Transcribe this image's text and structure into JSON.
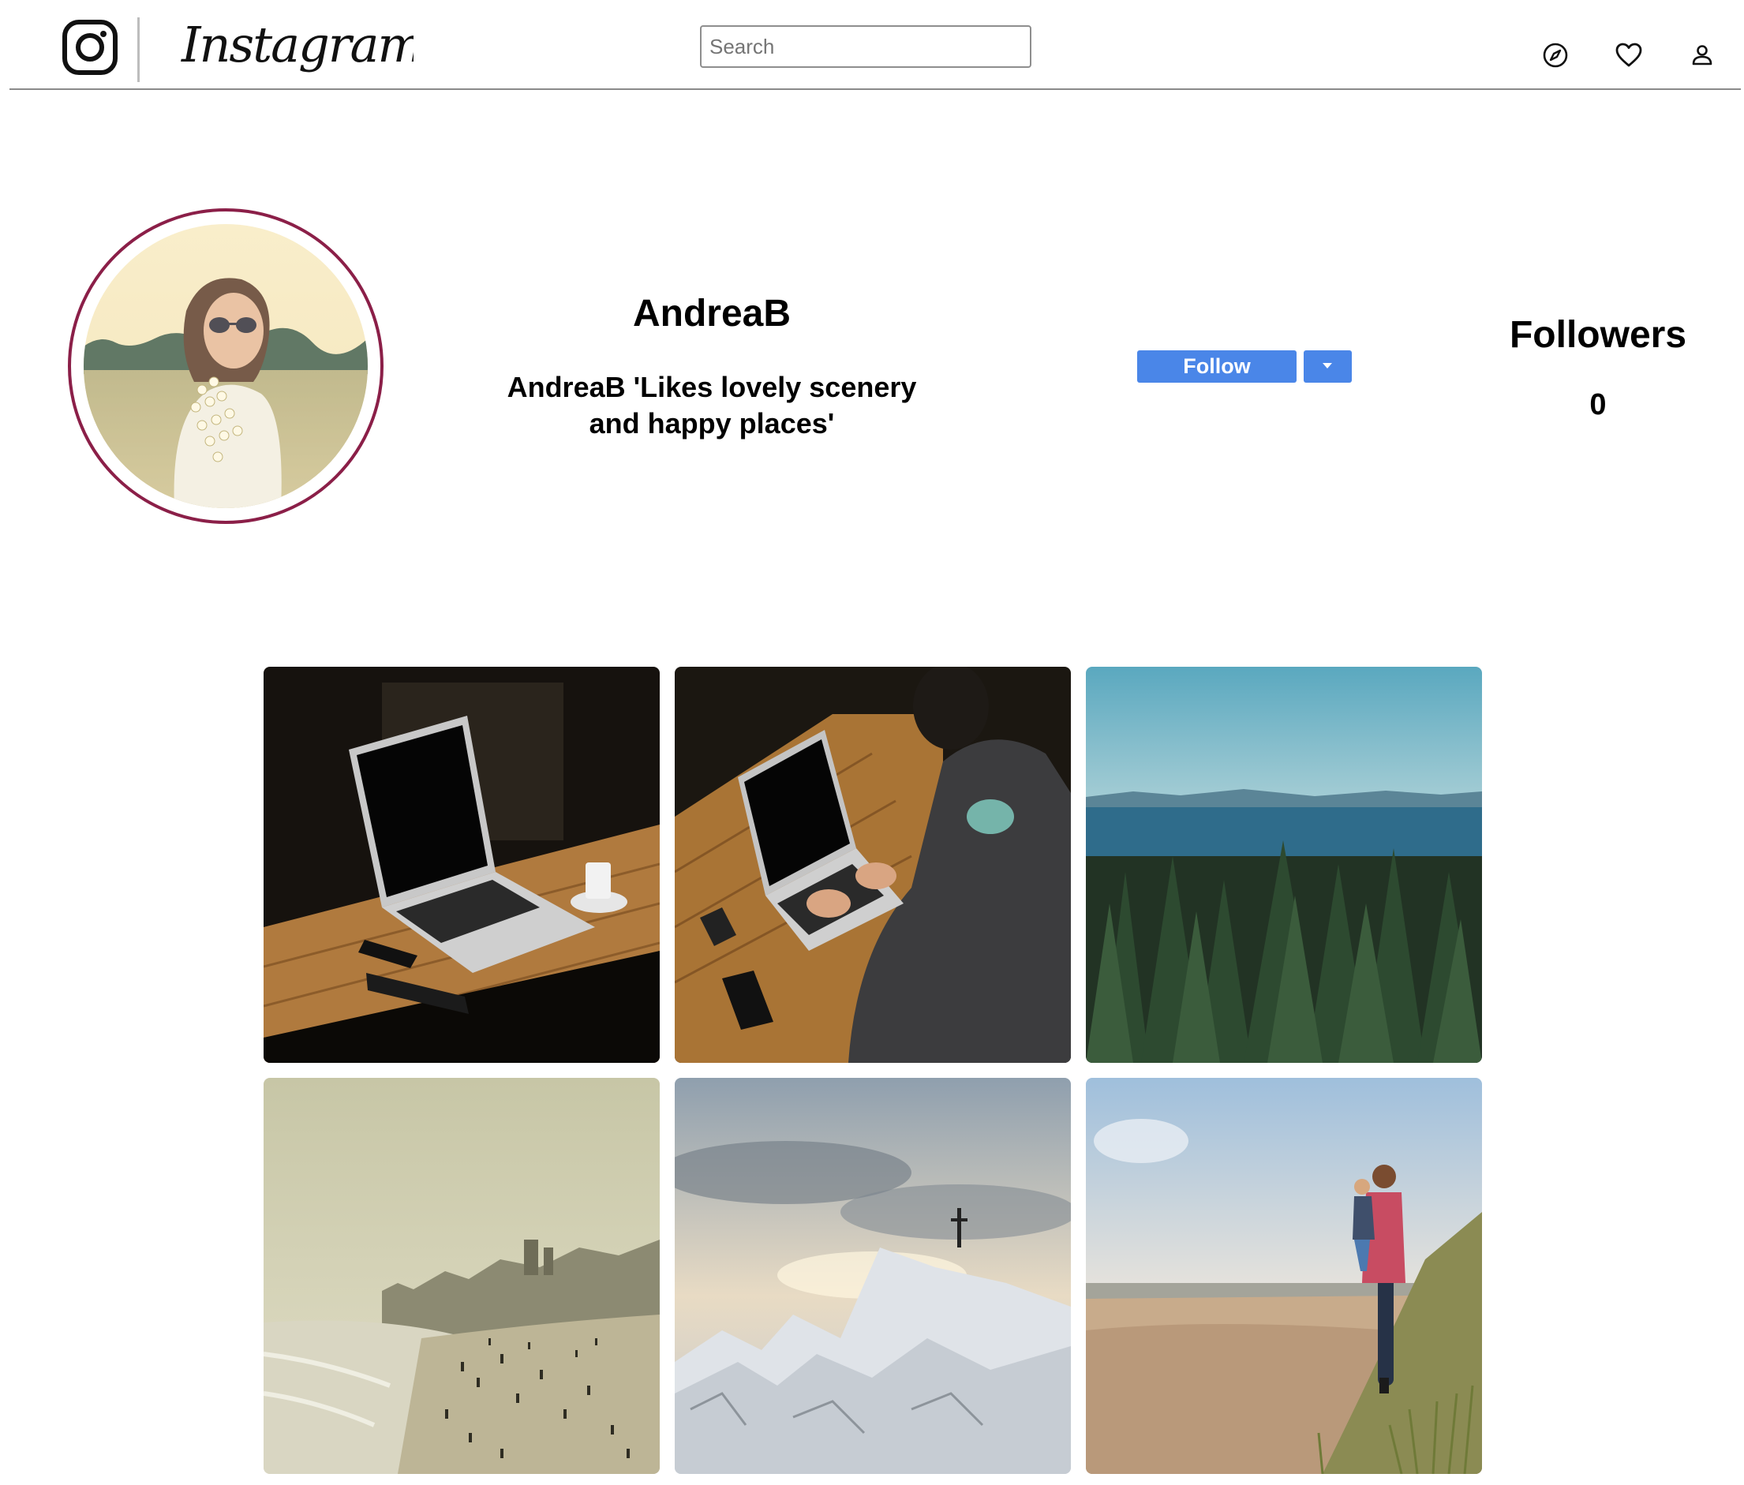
{
  "header": {
    "logo_glyph_icon": "instagram-camera-icon",
    "wordmark": "Instagram",
    "search": {
      "placeholder": "Search",
      "value": ""
    },
    "nav": [
      {
        "icon": "compass-icon",
        "label": "Explore"
      },
      {
        "icon": "heart-icon",
        "label": "Activity"
      },
      {
        "icon": "person-icon",
        "label": "Profile"
      }
    ]
  },
  "profile": {
    "username": "AndreaB",
    "bio": "AndreaB 'Likes lovely scenery and happy places'",
    "follow_button": "Follow",
    "followers_label": "Followers",
    "followers_count": "0",
    "avatar_ring_color": "#8b1f48"
  },
  "colors": {
    "accent": "#4a86e8",
    "divider": "#8a8a8a"
  },
  "posts": [
    {
      "subject": "laptop on wooden table with coffee cup"
    },
    {
      "subject": "man typing on laptop at wooden table"
    },
    {
      "subject": "pine forest with lake and mountains"
    },
    {
      "subject": "crowded beach in hazy light"
    },
    {
      "subject": "snowy summit with cross"
    },
    {
      "subject": "father carrying child on beach"
    }
  ]
}
